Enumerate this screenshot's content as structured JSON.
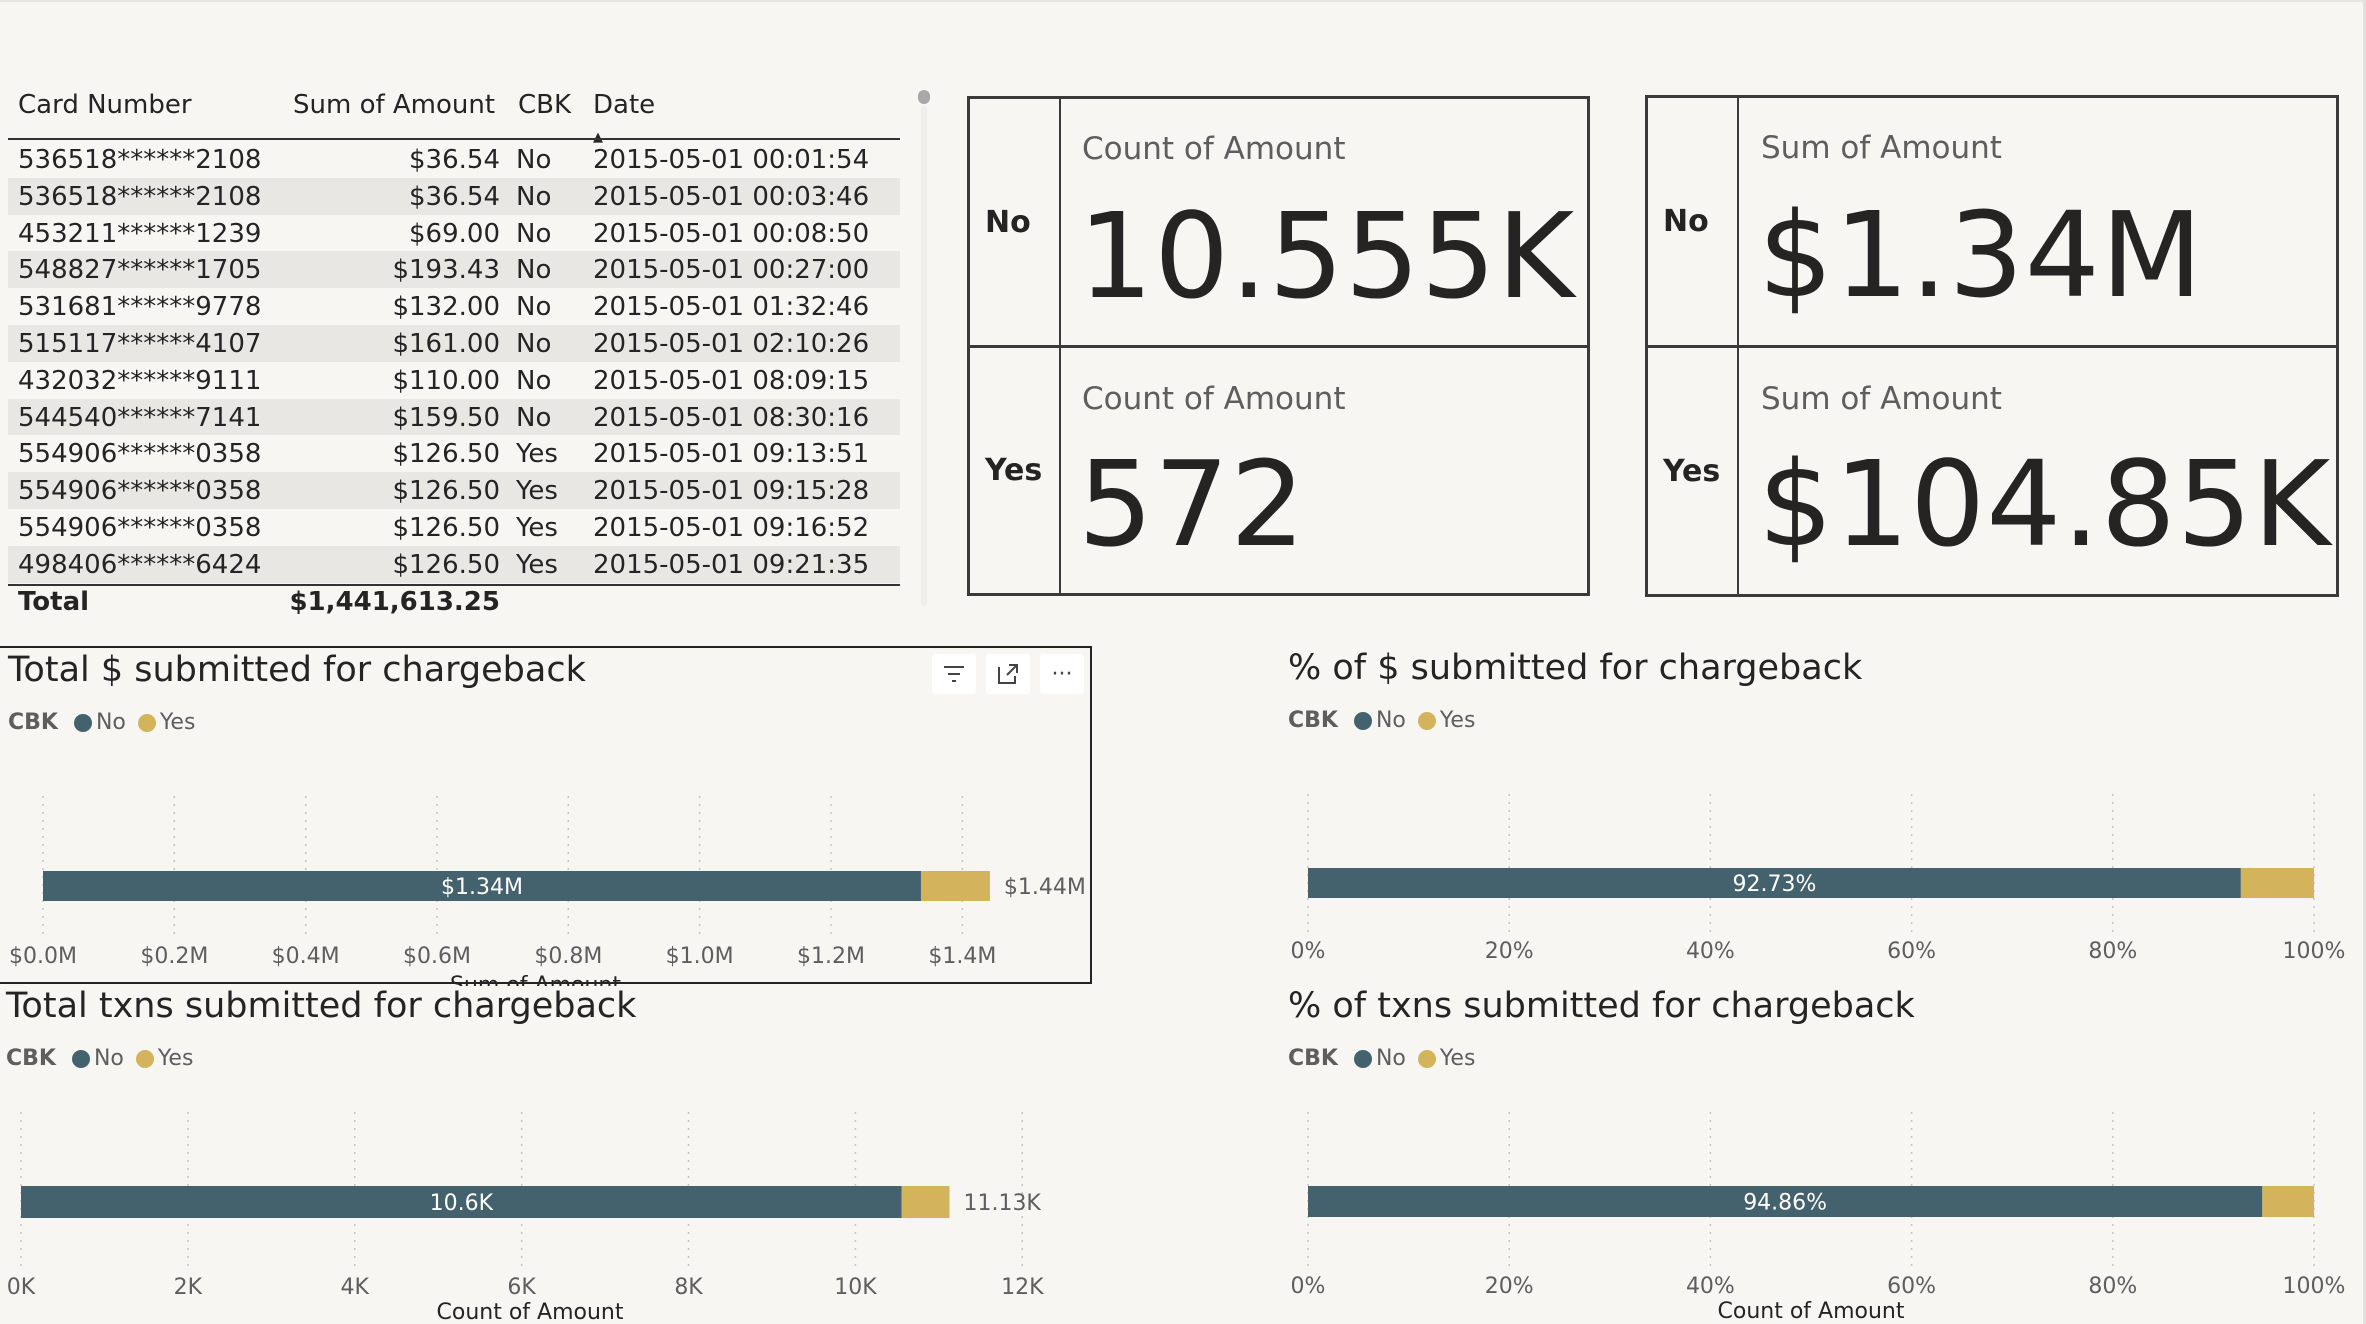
{
  "colors": {
    "no": "#44626d",
    "yes": "#d3b35c",
    "text": "#252423",
    "axis": "#605e5c"
  },
  "table": {
    "columns": [
      "Card Number",
      "Sum of Amount",
      "CBK",
      "Date"
    ],
    "sort_indicator_column": "Date",
    "rows": [
      [
        "536518******2108",
        "$36.54",
        "No",
        "2015-05-01 00:01:54"
      ],
      [
        "536518******2108",
        "$36.54",
        "No",
        "2015-05-01 00:03:46"
      ],
      [
        "453211******1239",
        "$69.00",
        "No",
        "2015-05-01 00:08:50"
      ],
      [
        "548827******1705",
        "$193.43",
        "No",
        "2015-05-01 00:27:00"
      ],
      [
        "531681******9778",
        "$132.00",
        "No",
        "2015-05-01 01:32:46"
      ],
      [
        "515117******4107",
        "$161.00",
        "No",
        "2015-05-01 02:10:26"
      ],
      [
        "432032******9111",
        "$110.00",
        "No",
        "2015-05-01 08:09:15"
      ],
      [
        "544540******7141",
        "$159.50",
        "No",
        "2015-05-01 08:30:16"
      ],
      [
        "554906******0358",
        "$126.50",
        "Yes",
        "2015-05-01 09:13:51"
      ],
      [
        "554906******0358",
        "$126.50",
        "Yes",
        "2015-05-01 09:15:28"
      ],
      [
        "554906******0358",
        "$126.50",
        "Yes",
        "2015-05-01 09:16:52"
      ],
      [
        "498406******6424",
        "$126.50",
        "Yes",
        "2015-05-01 09:21:35"
      ]
    ],
    "total_label": "Total",
    "total_amount": "$1,441,613.25"
  },
  "kpi_count": {
    "rows": [
      {
        "label": "No",
        "card_title": "Count of Amount",
        "value": "10.555K"
      },
      {
        "label": "Yes",
        "card_title": "Count of Amount",
        "value": "572"
      }
    ]
  },
  "kpi_sum": {
    "rows": [
      {
        "label": "No",
        "card_title": "Sum of Amount",
        "value": "$1.34M"
      },
      {
        "label": "Yes",
        "card_title": "Sum of Amount",
        "value": "$104.85K"
      }
    ]
  },
  "chart_data": [
    {
      "id": "c1",
      "type": "bar",
      "orientation": "horizontal",
      "stacked": true,
      "title": "Total $ submitted for chargeback",
      "legend_title": "CBK",
      "series": [
        {
          "name": "No",
          "values": [
            1.337
          ]
        },
        {
          "name": "Yes",
          "values": [
            0.105
          ]
        }
      ],
      "data_labels": [
        "$1.34M",
        ""
      ],
      "total_label": "$1.44M",
      "xlim": [
        0,
        1.5
      ],
      "xticks": [
        0,
        0.2,
        0.4,
        0.6,
        0.8,
        1.0,
        1.2,
        1.4
      ],
      "xtick_labels": [
        "$0.0M",
        "$0.2M",
        "$0.4M",
        "$0.6M",
        "$0.8M",
        "$1.0M",
        "$1.2M",
        "$1.4M"
      ],
      "xlabel": "Sum of Amount",
      "grid": true,
      "legend_position": "top-left"
    },
    {
      "id": "c2",
      "type": "bar",
      "orientation": "horizontal",
      "stacked": true,
      "title": "% of $ submitted for chargeback",
      "legend_title": "CBK",
      "series": [
        {
          "name": "No",
          "values": [
            92.73
          ]
        },
        {
          "name": "Yes",
          "values": [
            7.27
          ]
        }
      ],
      "data_labels": [
        "92.73%",
        ""
      ],
      "total_label": "",
      "xlim": [
        0,
        100
      ],
      "xticks": [
        0,
        20,
        40,
        60,
        80,
        100
      ],
      "xtick_labels": [
        "0%",
        "20%",
        "40%",
        "60%",
        "80%",
        "100%"
      ],
      "xlabel": "",
      "grid": true,
      "legend_position": "top-left"
    },
    {
      "id": "c3",
      "type": "bar",
      "orientation": "horizontal",
      "stacked": true,
      "title": "Total txns submitted for chargeback",
      "legend_title": "CBK",
      "series": [
        {
          "name": "No",
          "values": [
            10555
          ]
        },
        {
          "name": "Yes",
          "values": [
            572
          ]
        }
      ],
      "data_labels": [
        "10.6K",
        ""
      ],
      "total_label": "11.13K",
      "xlim": [
        0,
        12200
      ],
      "xticks": [
        0,
        2000,
        4000,
        6000,
        8000,
        10000,
        12000
      ],
      "xtick_labels": [
        "0K",
        "2K",
        "4K",
        "6K",
        "8K",
        "10K",
        "12K"
      ],
      "xlabel": "Count of Amount",
      "grid": true,
      "legend_position": "top-left"
    },
    {
      "id": "c4",
      "type": "bar",
      "orientation": "horizontal",
      "stacked": true,
      "title": "% of txns submitted for chargeback",
      "legend_title": "CBK",
      "series": [
        {
          "name": "No",
          "values": [
            94.86
          ]
        },
        {
          "name": "Yes",
          "values": [
            5.14
          ]
        }
      ],
      "data_labels": [
        "94.86%",
        ""
      ],
      "total_label": "",
      "xlim": [
        0,
        100
      ],
      "xticks": [
        0,
        20,
        40,
        60,
        80,
        100
      ],
      "xtick_labels": [
        "0%",
        "20%",
        "40%",
        "60%",
        "80%",
        "100%"
      ],
      "xlabel": "Count of Amount",
      "grid": true,
      "legend_position": "top-left"
    }
  ],
  "visual_header": {
    "filter_icon": "filter-icon",
    "focus_icon": "focus-mode-icon",
    "more_icon": "more-options-icon",
    "more_glyph": "···"
  }
}
